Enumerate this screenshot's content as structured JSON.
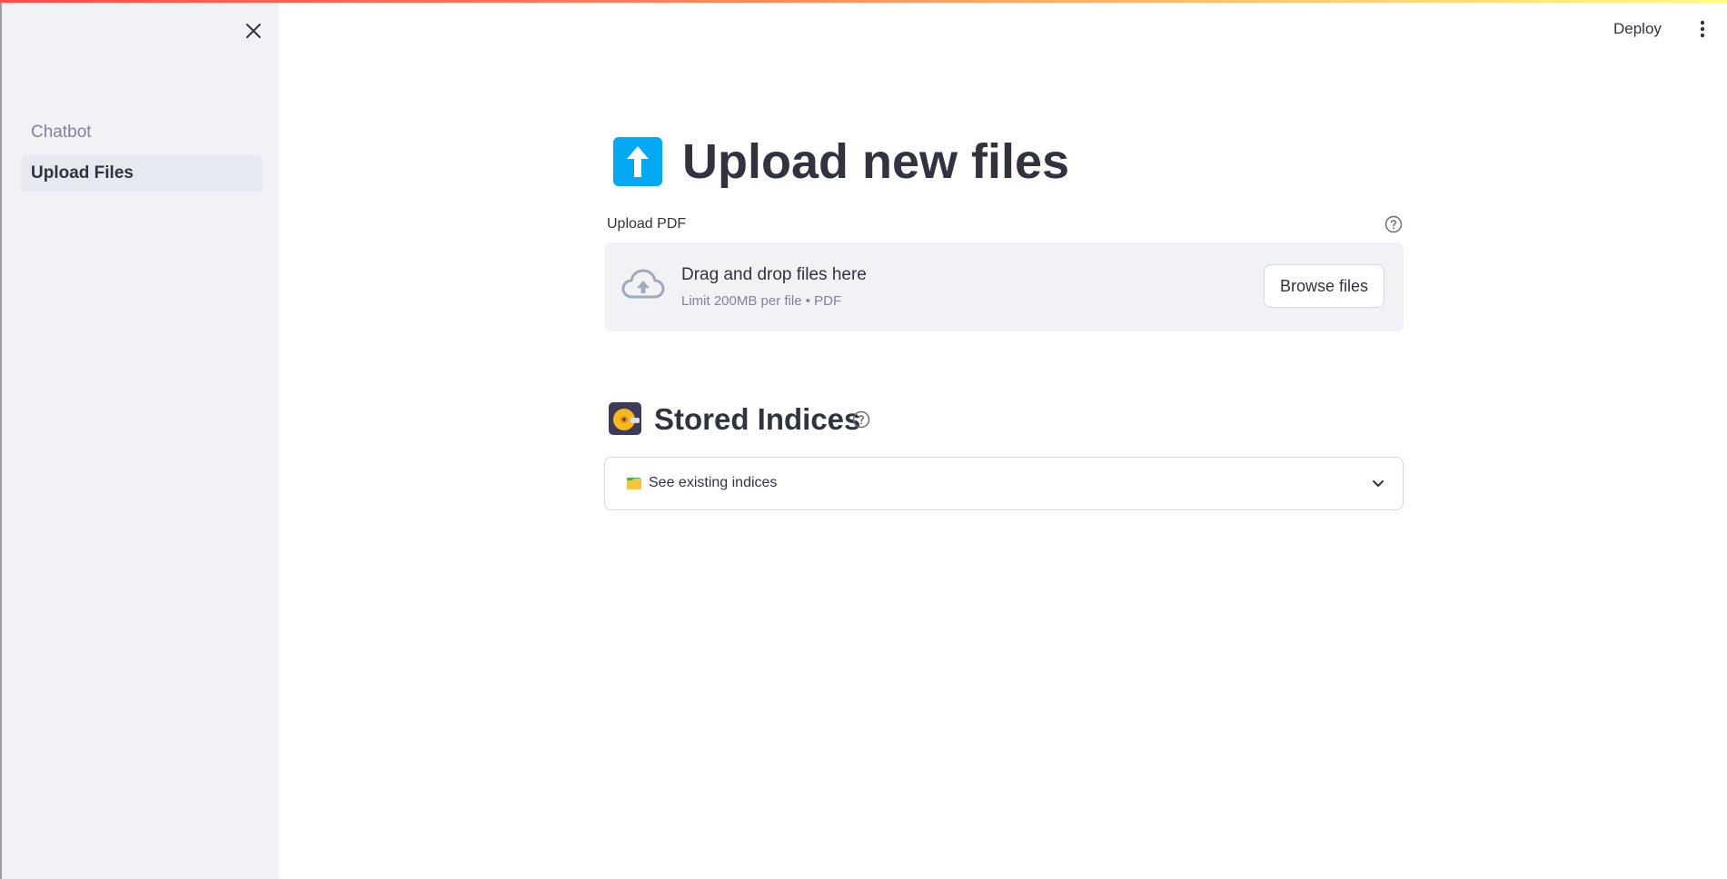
{
  "sidebar": {
    "items": [
      {
        "label": "Chatbot",
        "active": false
      },
      {
        "label": "Upload Files",
        "active": true
      }
    ]
  },
  "header": {
    "deploy_label": "Deploy"
  },
  "main": {
    "title": "Upload new files",
    "uploader": {
      "label": "Upload PDF",
      "drop_title": "Drag and drop files here",
      "drop_subtitle": "Limit 200MB per file • PDF",
      "browse_label": "Browse files"
    },
    "indices": {
      "title": "Stored Indices",
      "expander_label": "See existing indices"
    }
  },
  "colors": {
    "accent_blue": "#03a9f4",
    "sidebar_bg": "#f0f2f6",
    "text": "#31333f",
    "muted_text": "#808495"
  },
  "icons": [
    "close-icon",
    "up-arrow-icon",
    "help-icon",
    "cloud-upload-icon",
    "disk-icon",
    "folder-icon",
    "chevron-down-icon",
    "more-vertical-icon"
  ]
}
